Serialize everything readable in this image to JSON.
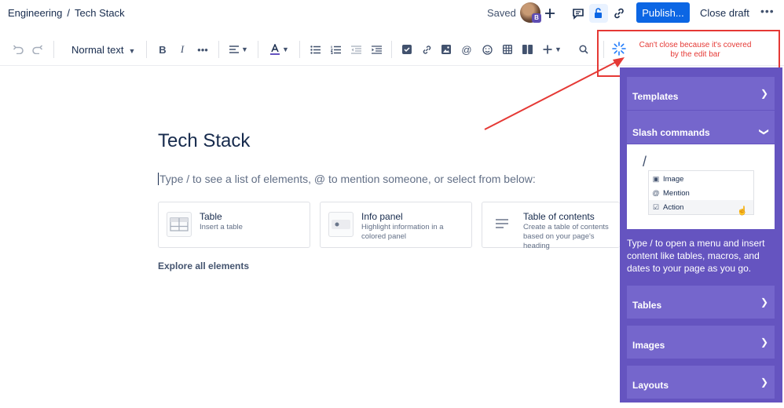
{
  "breadcrumb": {
    "space": "Engineering",
    "separator": "/",
    "page": "Tech Stack"
  },
  "header": {
    "saved_status": "Saved",
    "avatar_badge": "B",
    "publish_label": "Publish...",
    "close_draft_label": "Close draft",
    "more_label": "•••"
  },
  "toolbar": {
    "text_style": "Normal text",
    "more_formatting": "•••"
  },
  "annotation": {
    "text": "Can't close because it's covered by the edit bar",
    "color": "#e53935"
  },
  "editor": {
    "title": "Tech Stack",
    "placeholder": "Type / to see a list of elements, @ to mention someone, or select from below:",
    "cards": [
      {
        "title": "Table",
        "description": "Insert a table"
      },
      {
        "title": "Info panel",
        "description": "Highlight information in a colored panel"
      },
      {
        "title": "Table of contents",
        "description": "Create a table of contents based on your page's heading"
      }
    ],
    "explore_label": "Explore all elements"
  },
  "panel": {
    "bg_color": "#6554c0",
    "sections": {
      "templates": "Templates",
      "slash_commands": "Slash commands",
      "tables": "Tables",
      "images": "Images",
      "layouts": "Layouts"
    },
    "slash_preview": {
      "slash": "/",
      "items": [
        "Image",
        "Mention",
        "Action"
      ]
    },
    "slash_description": "Type / to open a menu and insert content like tables, macros, and dates to your page as you go."
  },
  "colors": {
    "primary": "#0c66e4",
    "text": "#172b4d"
  }
}
